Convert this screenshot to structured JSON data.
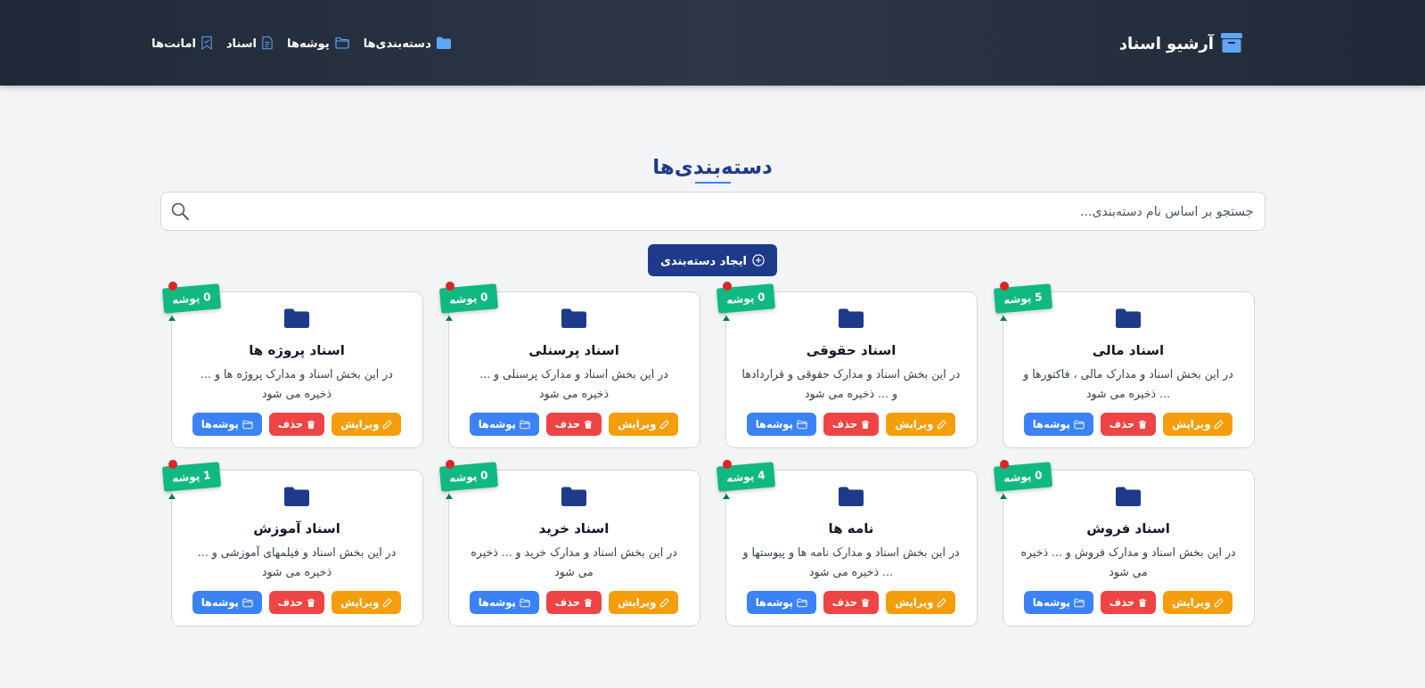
{
  "header": {
    "brand": "آرشیو اسناد",
    "nav": [
      {
        "label": "دسته‌بندی‌ها",
        "kind": "categories"
      },
      {
        "label": "پوشه‌ها",
        "kind": "folders"
      },
      {
        "label": "اسناد",
        "kind": "documents"
      },
      {
        "label": "امانت‌ها",
        "kind": "loans"
      }
    ]
  },
  "page_title": "دسته‌بندی‌ها",
  "search": {
    "placeholder": "جستجو بر اساس نام دسته‌بندی..."
  },
  "create_button": "ایجاد دسته‌بندی",
  "categories": [
    {
      "badge": "5 پوشه",
      "title": "اسناد مالی",
      "description": "در این بخش اسناد و مدارک مالی ، فاکتورها و ... ذخیره می شود",
      "actions": [
        "ویرایش",
        "حذف",
        "پوشه‌ها"
      ]
    },
    {
      "badge": "0 پوشه",
      "title": "اسناد حقوقی",
      "description": "در این بخش اسناد و مدارک حقوقی و قراردادها و ... ذخیره می شود",
      "actions": [
        "ویرایش",
        "حذف",
        "پوشه‌ها"
      ]
    },
    {
      "badge": "0 پوشه",
      "title": "اسناد پرسنلی",
      "description": "در این بخش اسناد و مدارک پرسنلی و ... ذخیره می شود",
      "actions": [
        "ویرایش",
        "حذف",
        "پوشه‌ها"
      ]
    },
    {
      "badge": "0 پوشه",
      "title": "اسناد پروژه ها",
      "description": "در این بخش اسناد و مدارک پروژه ها و ... ذخیره می شود",
      "actions": [
        "ویرایش",
        "حذف",
        "پوشه‌ها"
      ]
    },
    {
      "badge": "0 پوشه",
      "title": "اسناد فروش",
      "description": "در این بخش اسناد و مدارک فروش و ... ذخیره می شود",
      "actions": [
        "ویرایش",
        "حذف",
        "پوشه‌ها"
      ]
    },
    {
      "badge": "4 پوشه",
      "title": "نامه ها",
      "description": "در این بخش اسناد و مدارک نامه ها و پیوستها و ... ذخیره می شود",
      "actions": [
        "ویرایش",
        "حذف",
        "پوشه‌ها"
      ]
    },
    {
      "badge": "0 پوشه",
      "title": "اسناد خرید",
      "description": "در این بخش اسناد و مدارک خرید و ... ذخیره می شود",
      "actions": [
        "ویرایش",
        "حذف",
        "پوشه‌ها"
      ]
    },
    {
      "badge": "1 پوشه",
      "title": "اسناد آموزش",
      "description": "در این بخش اسناد و فیلمهای آموزشی و ... ذخیره می شود",
      "actions": [
        "ویرایش",
        "حذف",
        "پوشه‌ها"
      ]
    }
  ]
}
